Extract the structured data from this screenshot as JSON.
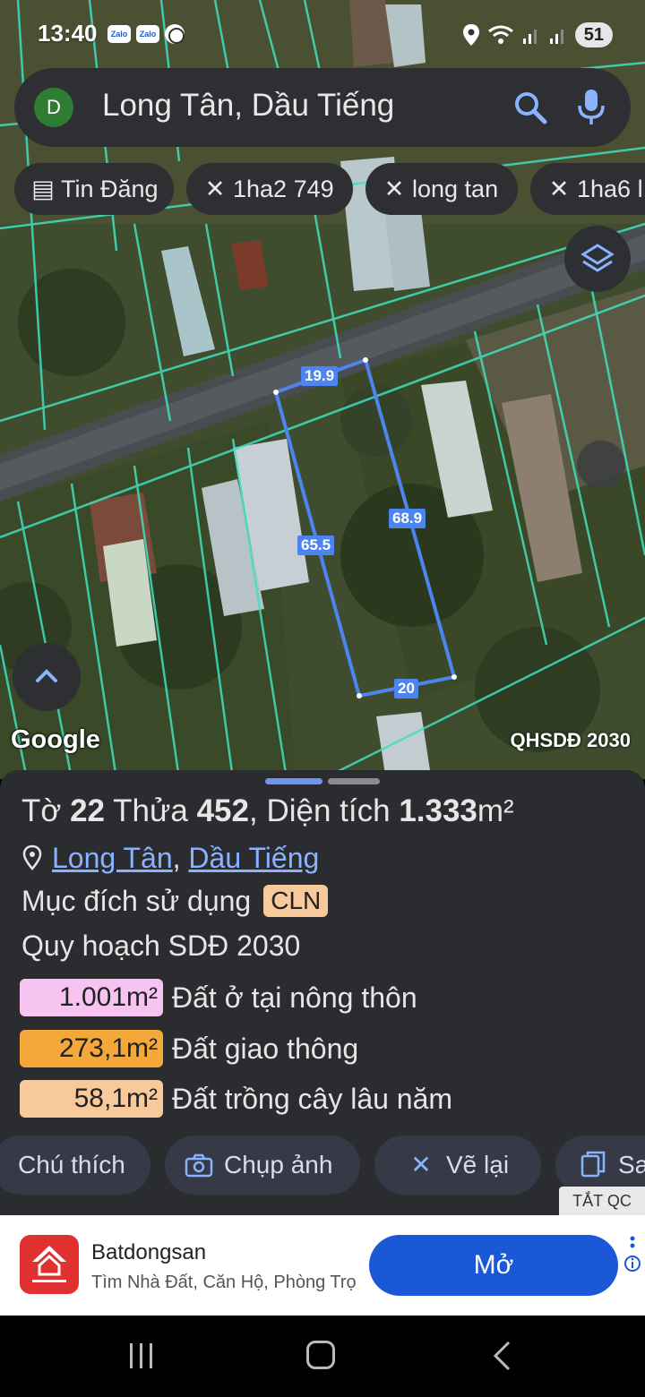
{
  "status_bar": {
    "time": "13:40",
    "zalo1": "Zalo",
    "zalo2": "Zalo",
    "battery": "51"
  },
  "search": {
    "avatar_letter": "D",
    "query": "Long Tân, Dầu Tiếng"
  },
  "chips": [
    {
      "label": "Tin Đăng",
      "icon": "calendar-icon"
    },
    {
      "label": "1ha2 749",
      "icon": "ruler-icon"
    },
    {
      "label": "long tan",
      "icon": "ruler-icon"
    },
    {
      "label": "1ha6 l",
      "icon": "ruler-icon"
    }
  ],
  "map": {
    "logo": "Google",
    "layer_label": "QHSDĐ 2030",
    "measurements": {
      "top": "19.9",
      "right": "68.9",
      "left": "65.5",
      "bottom": "20"
    }
  },
  "parcel": {
    "to_label": "Tờ",
    "to_value": "22",
    "thua_label": "Thửa",
    "thua_value": "452",
    "area_label": ", Diện tích",
    "area_value": "1.333",
    "area_unit": "m²",
    "location_ward": "Long Tân",
    "location_sep": ",",
    "location_district": "Dầu Tiếng",
    "purpose_label": "Mục đích sử dụng",
    "purpose_code": "CLN",
    "plan_label": "Quy hoạch SDĐ 2030",
    "land_uses": [
      {
        "area": "1.001m²",
        "label": "Đất ở tại nông thôn",
        "color": "#f7c4f2"
      },
      {
        "area": "273,1m²",
        "label": "Đất giao thông",
        "color": "#f5a83a"
      },
      {
        "area": "58,1m²",
        "label": "Đất trồng cây lâu năm",
        "color": "#f8c99a"
      }
    ]
  },
  "actions": [
    {
      "label": "Chú thích",
      "icon": "note-icon"
    },
    {
      "label": "Chụp ảnh",
      "icon": "camera-icon"
    },
    {
      "label": "Vẽ lại",
      "icon": "ruler-icon"
    },
    {
      "label": "Sa",
      "icon": "copy-icon"
    }
  ],
  "ad": {
    "dismiss": "TẮT QC",
    "title": "Batdongsan",
    "subtitle": "Tìm Nhà Đất, Căn Hộ, Phòng Trọ",
    "cta": "Mở"
  },
  "colors": {
    "accent": "#8ab2ff",
    "sheet_bg": "#2a2c30",
    "cta_blue": "#1a58d6",
    "measure_line": "#4c84f0"
  }
}
